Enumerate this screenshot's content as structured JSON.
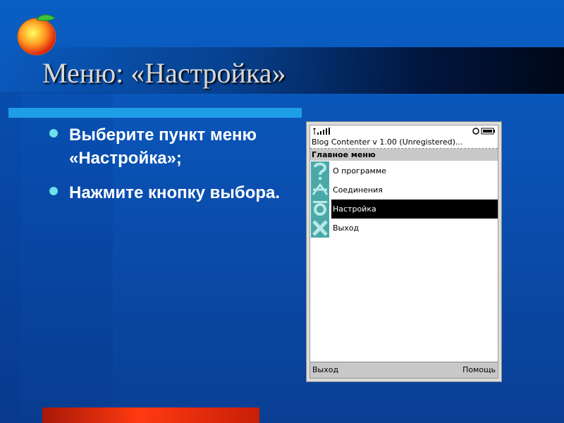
{
  "slide": {
    "title": "Меню: «Настройка»",
    "bullets": [
      "Выберите пункт меню «Настройка»;",
      "Нажмите кнопку выбора."
    ]
  },
  "phone": {
    "app_title": "Blog Contenter v 1.00 (Unregistered)...",
    "menu_header": "Главное меню",
    "menu_items": [
      {
        "label": "О программе",
        "icon": "question-icon"
      },
      {
        "label": "Соединения",
        "icon": "connections-icon"
      },
      {
        "label": "Настройка",
        "icon": "settings-icon",
        "selected": true
      },
      {
        "label": "Выход",
        "icon": "exit-icon"
      }
    ],
    "softkey_left": "Выход",
    "softkey_right": "Помощь"
  },
  "colors": {
    "background": "#0a5fc4",
    "title_underline": "#1e9ee6",
    "bullet": "#6ee0ea",
    "bottom_bar": "#ff3a10",
    "selected_bg": "#000000"
  }
}
